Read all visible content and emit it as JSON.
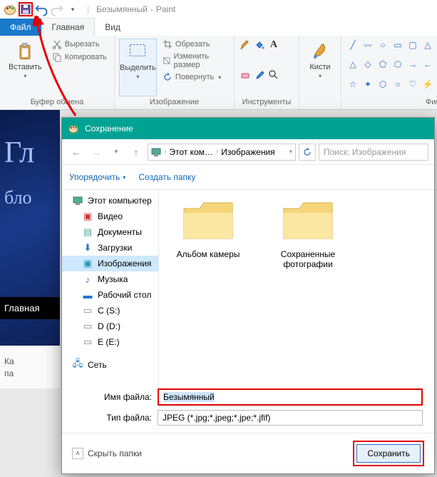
{
  "titlebar": {
    "doc_name": "Безымянный",
    "app_name": "Paint"
  },
  "tabs": {
    "file": "Файл",
    "home": "Главная",
    "view": "Вид"
  },
  "ribbon": {
    "clipboard": {
      "paste": "Вставить",
      "cut": "Вырезать",
      "copy": "Копировать",
      "group": "Буфер обмена"
    },
    "image": {
      "select": "Выделить",
      "crop": "Обрезать",
      "resize": "Изменить размер",
      "rotate": "Повернуть",
      "group": "Изображение"
    },
    "tools": {
      "group": "Инструменты"
    },
    "brushes": {
      "label": "Кисти"
    },
    "shapes": {
      "group": "Фигур"
    }
  },
  "canvas": {
    "txt1": "Гл",
    "txt2": "бло",
    "nav": "Главная",
    "bottom1": "Ка",
    "bottom2": "па"
  },
  "dialog": {
    "title": "Сохранение",
    "crumb1": "Этот ком…",
    "crumb2": "Изображения",
    "search_placeholder": "Поиск: Изображения",
    "organize": "Упорядочить",
    "new_folder": "Создать папку",
    "tree": {
      "this_pc": "Этот компьютер",
      "videos": "Видео",
      "documents": "Документы",
      "downloads": "Загрузки",
      "pictures": "Изображения",
      "music": "Музыка",
      "desktop": "Рабочий стол",
      "c": "C (S:)",
      "d": "D (D:)",
      "e": "E (E:)",
      "network": "Сеть"
    },
    "folders": {
      "f1": "Альбом камеры",
      "f2": "Сохраненные фотографии"
    },
    "filename_label": "Имя файла:",
    "filename_value": "Безымянный",
    "filetype_label": "Тип файла:",
    "filetype_value": "JPEG (*.jpg;*.jpeg;*.jpe;*.jfif)",
    "hide_folders": "Скрыть папки",
    "save": "Сохранить"
  }
}
